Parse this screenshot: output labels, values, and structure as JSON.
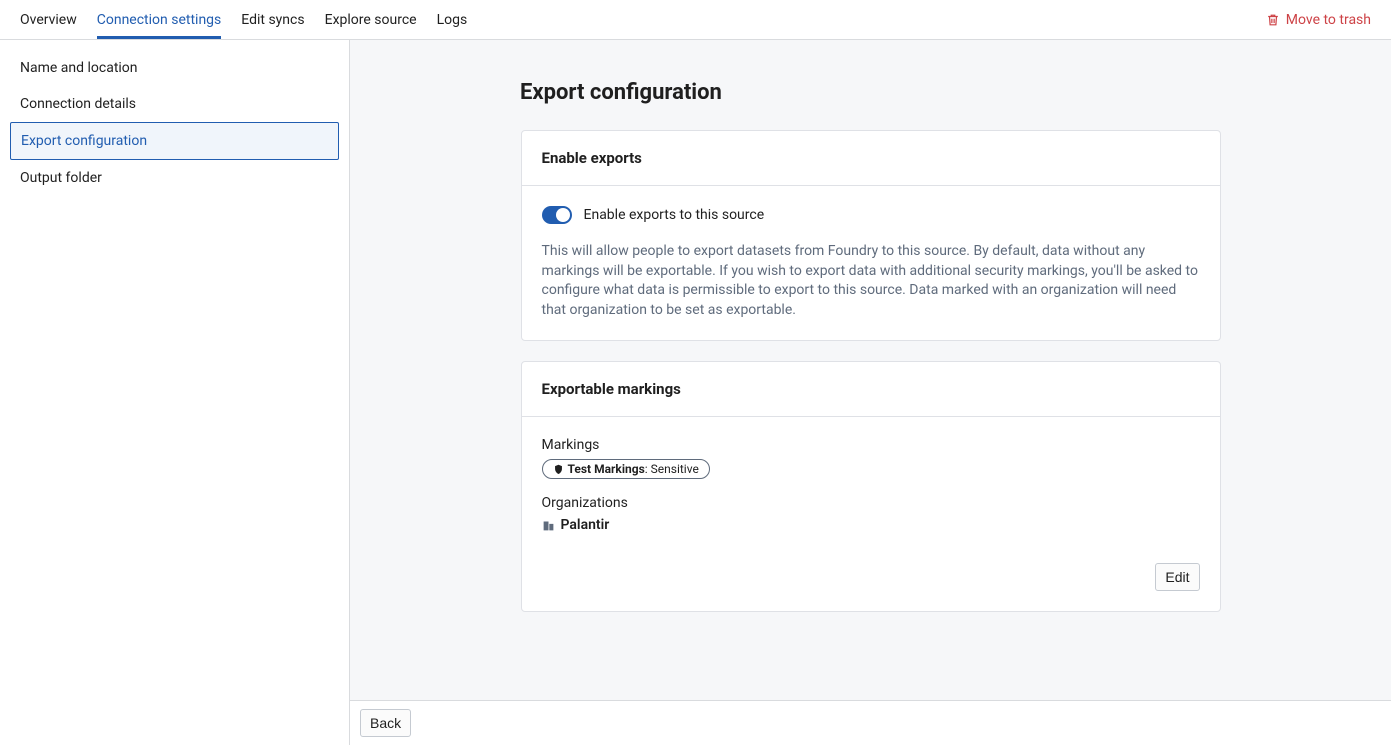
{
  "topNav": {
    "tabs": [
      {
        "id": "overview",
        "label": "Overview"
      },
      {
        "id": "connection-settings",
        "label": "Connection settings"
      },
      {
        "id": "edit-syncs",
        "label": "Edit syncs"
      },
      {
        "id": "explore-source",
        "label": "Explore source"
      },
      {
        "id": "logs",
        "label": "Logs"
      }
    ],
    "trashLabel": "Move to trash"
  },
  "sidebar": {
    "items": [
      {
        "id": "name-location",
        "label": "Name and location"
      },
      {
        "id": "connection-details",
        "label": "Connection details"
      },
      {
        "id": "export-configuration",
        "label": "Export configuration"
      },
      {
        "id": "output-folder",
        "label": "Output folder"
      }
    ]
  },
  "page": {
    "title": "Export configuration"
  },
  "enableExports": {
    "header": "Enable exports",
    "toggleOn": true,
    "toggleLabel": "Enable exports to this source",
    "helpText": "This will allow people to export datasets from Foundry to this source. By default, data without any markings will be exportable. If you wish to export data with additional security markings, you'll be asked to configure what data is permissible to export to this source. Data marked with an organization will need that organization to be set as exportable."
  },
  "exportableMarkings": {
    "header": "Exportable markings",
    "markingsLabel": "Markings",
    "markingChipPrefix": "Test Markings",
    "markingChipSuffix": ": Sensitive",
    "organizationsLabel": "Organizations",
    "orgName": "Palantir",
    "editLabel": "Edit"
  },
  "footer": {
    "backLabel": "Back"
  }
}
